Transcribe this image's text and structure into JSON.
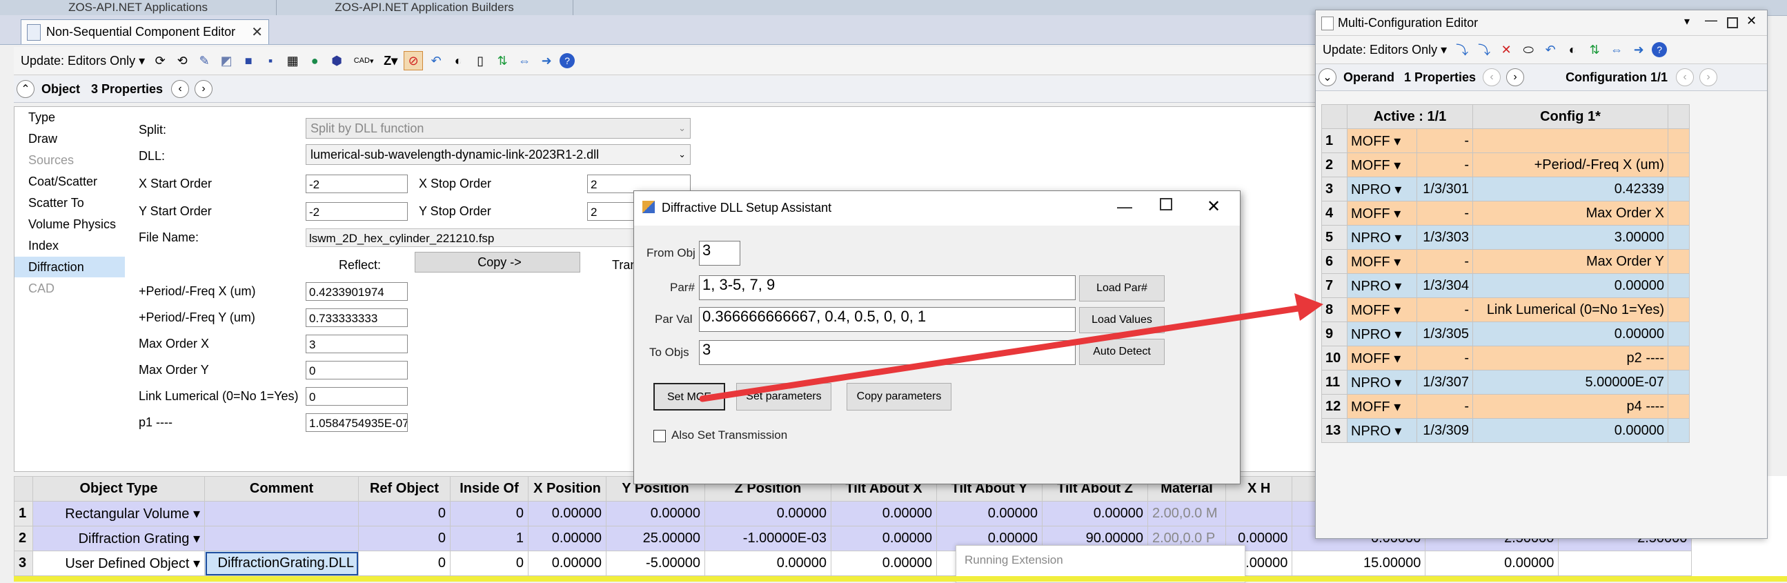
{
  "app_tabs": [
    "ZOS-API.NET Applications",
    "ZOS-API.NET Application Builders"
  ],
  "nsce": {
    "tab_title": "Non-Sequential Component Editor",
    "update_label": "Update: Editors Only",
    "cad_label": "CAD",
    "prop_bar": {
      "object_label": "Object",
      "props_label": "3 Properties"
    },
    "nav": [
      "Type",
      "Draw",
      "Sources",
      "Coat/Scatter",
      "Scatter To",
      "Volume Physics",
      "Index",
      "Diffraction",
      "CAD"
    ],
    "fields": {
      "split_label": "Split:",
      "split_value": "Split by DLL function",
      "dll_label": "DLL:",
      "dll_value": "lumerical-sub-wavelength-dynamic-link-2023R1-2.dll",
      "xstart_label": "X Start Order",
      "xstart_value": "-2",
      "xstop_label": "X Stop Order",
      "xstop_value": "2",
      "ystart_label": "Y Start Order",
      "ystart_value": "-2",
      "ystop_label": "Y Stop Order",
      "ystop_value": "2",
      "file_label": "File Name:",
      "file_value": "lswm_2D_hex_cylinder_221210.fsp",
      "reflect_label": "Reflect:",
      "copy_button": "Copy ->",
      "trans_label": "Tran",
      "period_x_label": "+Period/-Freq X (um)",
      "period_x_value": "0.4233901974",
      "period_y_label": "+Period/-Freq Y (um)",
      "period_y_value": "0.733333333",
      "max_x_label": "Max Order X",
      "max_x_value": "3",
      "max_y_label": "Max Order Y",
      "max_y_value": "0",
      "link_label": "Link Lumerical (0=No 1=Yes)",
      "link_value": "0",
      "p1_label": "p1 ----",
      "p1_value": "1.0584754935E-07"
    },
    "grid": {
      "headers": [
        "Object Type",
        "Comment",
        "Ref Object",
        "Inside Of",
        "X Position",
        "Y Position",
        "Z Position",
        "Tilt About X",
        "Tilt About Y",
        "Tilt About Z",
        "Material",
        "X H"
      ],
      "rows": [
        {
          "n": "1",
          "type": "Rectangular Volume",
          "comment": "",
          "ref": "0",
          "inside": "0",
          "x": "0.00000",
          "y": "0.00000",
          "z": "0.00000",
          "tx": "0.00000",
          "ty": "0.00000",
          "tz": "0.00000",
          "mat": "2.00,0.0",
          "matflag": "M",
          "extra": ""
        },
        {
          "n": "2",
          "type": "Diffraction Grating",
          "comment": "",
          "ref": "0",
          "inside": "1",
          "x": "0.00000",
          "y": "25.00000",
          "z": "-1.00000E-03",
          "tx": "0.00000",
          "ty": "0.00000",
          "tz": "90.00000",
          "mat": "2.00,0.0",
          "matflag": "P",
          "extra": ""
        },
        {
          "n": "3",
          "type": "User Defined Object",
          "comment": "DiffractionGrating.DLL",
          "ref": "0",
          "inside": "0",
          "x": "0.00000",
          "y": "-5.00000",
          "z": "0.00000",
          "tx": "0.00000",
          "ty": "",
          "tz": "",
          "mat": "",
          "matflag": "",
          "extra": ""
        }
      ],
      "row3_tail": [
        "20.00000",
        "15.00000",
        "0.00000"
      ],
      "row2_tail": [
        "0.00000",
        "0.00000",
        "2.50000",
        "2.50000"
      ]
    },
    "running_extension": "Running Extension"
  },
  "dialog": {
    "title": "Diffractive DLL Setup Assistant",
    "from_obj_label": "From Obj",
    "from_obj_value": "3",
    "par_label": "Par#",
    "par_value": "1, 3-5, 7, 9",
    "parval_label": "Par Val",
    "parval_value": "0.366666666667,  0.4,  0.5,  0,  0,  1",
    "toobjs_label": "To Objs",
    "toobjs_value": "3",
    "load_par_button": "Load Par#",
    "load_values_button": "Load Values",
    "auto_detect_button": "Auto Detect",
    "set_mce_button": "Set MCE",
    "set_params_button": "Set parameters",
    "copy_params_button": "Copy parameters",
    "also_transmission_label": "Also Set Transmission"
  },
  "mce": {
    "title": "Multi-Configuration Editor",
    "update_label": "Update: Editors Only",
    "operand_label": "Operand",
    "props_label": "1 Properties",
    "config_label": "Configuration 1/1",
    "col_active": "Active : 1/1",
    "col_config": "Config 1*",
    "rows": [
      {
        "n": "1",
        "op": "MOFF",
        "p": "-",
        "val": "",
        "kind": "moff"
      },
      {
        "n": "2",
        "op": "MOFF",
        "p": "-",
        "val": "+Period/-Freq X (um)",
        "kind": "moff"
      },
      {
        "n": "3",
        "op": "NPRO",
        "p": "1/3/301",
        "val": "0.42339",
        "kind": "npro"
      },
      {
        "n": "4",
        "op": "MOFF",
        "p": "-",
        "val": "Max Order X",
        "kind": "moff"
      },
      {
        "n": "5",
        "op": "NPRO",
        "p": "1/3/303",
        "val": "3.00000",
        "kind": "npro"
      },
      {
        "n": "6",
        "op": "MOFF",
        "p": "-",
        "val": "Max Order Y",
        "kind": "moff"
      },
      {
        "n": "7",
        "op": "NPRO",
        "p": "1/3/304",
        "val": "0.00000",
        "kind": "npro"
      },
      {
        "n": "8",
        "op": "MOFF",
        "p": "-",
        "val": "Link Lumerical (0=No 1=Yes)",
        "kind": "moff"
      },
      {
        "n": "9",
        "op": "NPRO",
        "p": "1/3/305",
        "val": "0.00000",
        "kind": "npro"
      },
      {
        "n": "10",
        "op": "MOFF",
        "p": "-",
        "val": "p2 ----",
        "kind": "moff"
      },
      {
        "n": "11",
        "op": "NPRO",
        "p": "1/3/307",
        "val": "5.00000E-07",
        "kind": "npro"
      },
      {
        "n": "12",
        "op": "MOFF",
        "p": "-",
        "val": "p4 ----",
        "kind": "moff"
      },
      {
        "n": "13",
        "op": "NPRO",
        "p": "1/3/309",
        "val": "0.00000",
        "kind": "npro"
      }
    ]
  },
  "colors": {
    "arrow": "#e8373a",
    "moff": "#fcd3a8",
    "npro": "#c9dfee",
    "grid_highlight": "#d4d4f7",
    "yellow_bar": "#f1ee3c"
  }
}
